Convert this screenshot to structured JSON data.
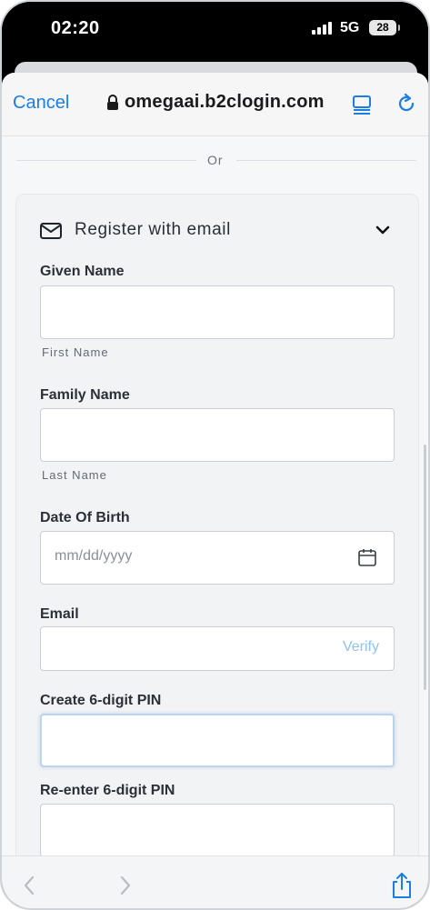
{
  "status_bar": {
    "time": "02:20",
    "network": "5G",
    "battery": "28"
  },
  "browser": {
    "cancel_label": "Cancel",
    "url": "omegaai.b2clogin.com"
  },
  "divider": {
    "text": "Or"
  },
  "register": {
    "title": "Register with email",
    "fields": {
      "given_name": {
        "label": "Given Name",
        "value": "",
        "hint": "First Name"
      },
      "family_name": {
        "label": "Family Name",
        "value": "",
        "hint": "Last Name"
      },
      "dob": {
        "label": "Date Of Birth",
        "placeholder": "mm/dd/yyyy"
      },
      "email": {
        "label": "Email",
        "value": "",
        "action": "Verify"
      },
      "pin": {
        "label": "Create 6-digit PIN",
        "value": ""
      },
      "pin_confirm": {
        "label": "Re-enter 6-digit PIN",
        "value": ""
      }
    }
  },
  "colors": {
    "accent": "#1a7ee5",
    "verify": "#8fc3ee",
    "label": "#2b3037"
  }
}
